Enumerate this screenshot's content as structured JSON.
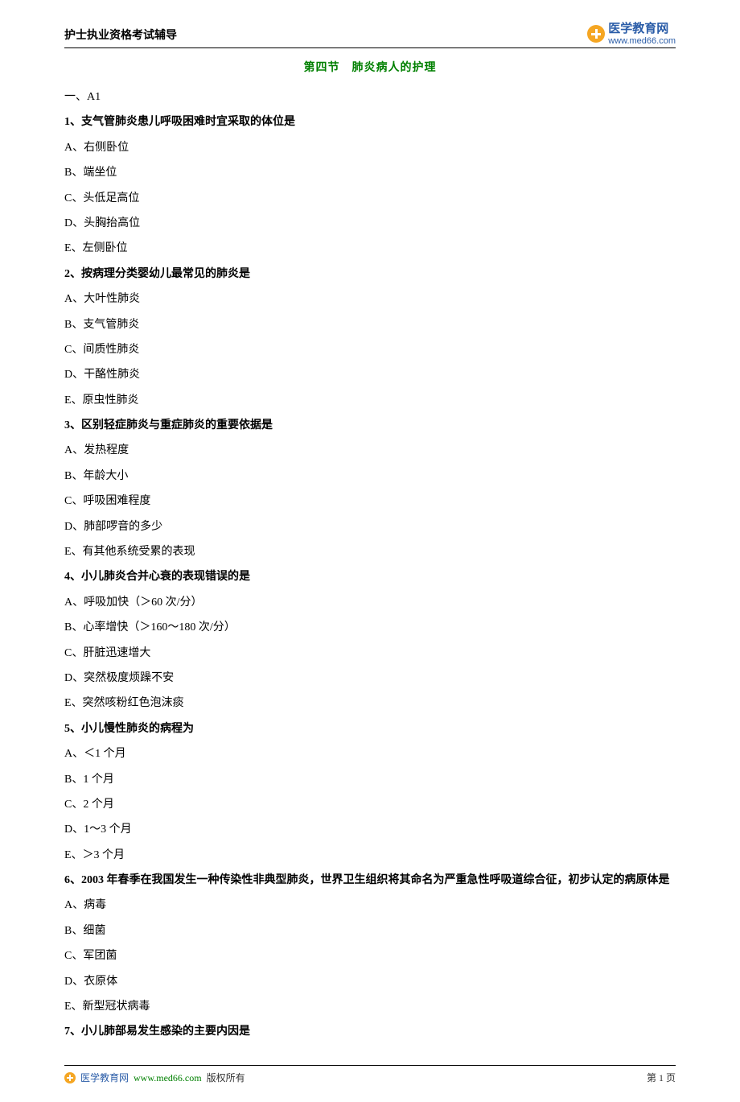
{
  "header": {
    "title": "护士执业资格考试辅导",
    "logo_cn": "医学教育网",
    "logo_url": "www.med66.com"
  },
  "section_title": "第四节　肺炎病人的护理",
  "category": "一、A1",
  "questions": [
    {
      "stem": "1、支气管肺炎患儿呼吸困难时宜采取的体位是",
      "options": [
        "A、右侧卧位",
        "B、端坐位",
        "C、头低足高位",
        "D、头胸抬高位",
        "E、左侧卧位"
      ]
    },
    {
      "stem": "2、按病理分类婴幼儿最常见的肺炎是",
      "options": [
        "A、大叶性肺炎",
        "B、支气管肺炎",
        "C、间质性肺炎",
        "D、干酪性肺炎",
        "E、原虫性肺炎"
      ]
    },
    {
      "stem": "3、区别轻症肺炎与重症肺炎的重要依据是",
      "options": [
        "A、发热程度",
        "B、年龄大小",
        "C、呼吸困难程度",
        "D、肺部啰音的多少",
        "E、有其他系统受累的表现"
      ]
    },
    {
      "stem": "4、小儿肺炎合并心衰的表现错误的是",
      "options": [
        "A、呼吸加快（＞60 次/分）",
        "B、心率增快（＞160～180 次/分）",
        "C、肝脏迅速增大",
        "D、突然极度烦躁不安",
        "E、突然咳粉红色泡沫痰"
      ]
    },
    {
      "stem": "5、小儿慢性肺炎的病程为",
      "options": [
        "A、＜1 个月",
        "B、1 个月",
        "C、2 个月",
        "D、1～3 个月",
        "E、＞3 个月"
      ]
    },
    {
      "stem": "6、2003 年春季在我国发生一种传染性非典型肺炎，世界卫生组织将其命名为严重急性呼吸道综合征，初步认定的病原体是",
      "options": [
        "A、病毒",
        "B、细菌",
        "C、军团菌",
        "D、衣原体",
        "E、新型冠状病毒"
      ]
    },
    {
      "stem": "7、小儿肺部易发生感染的主要内因是",
      "options": []
    }
  ],
  "footer": {
    "brand": "医学教育网",
    "url": "www.med66.com",
    "copyright": "版权所有",
    "page_num": "第 1 页"
  }
}
